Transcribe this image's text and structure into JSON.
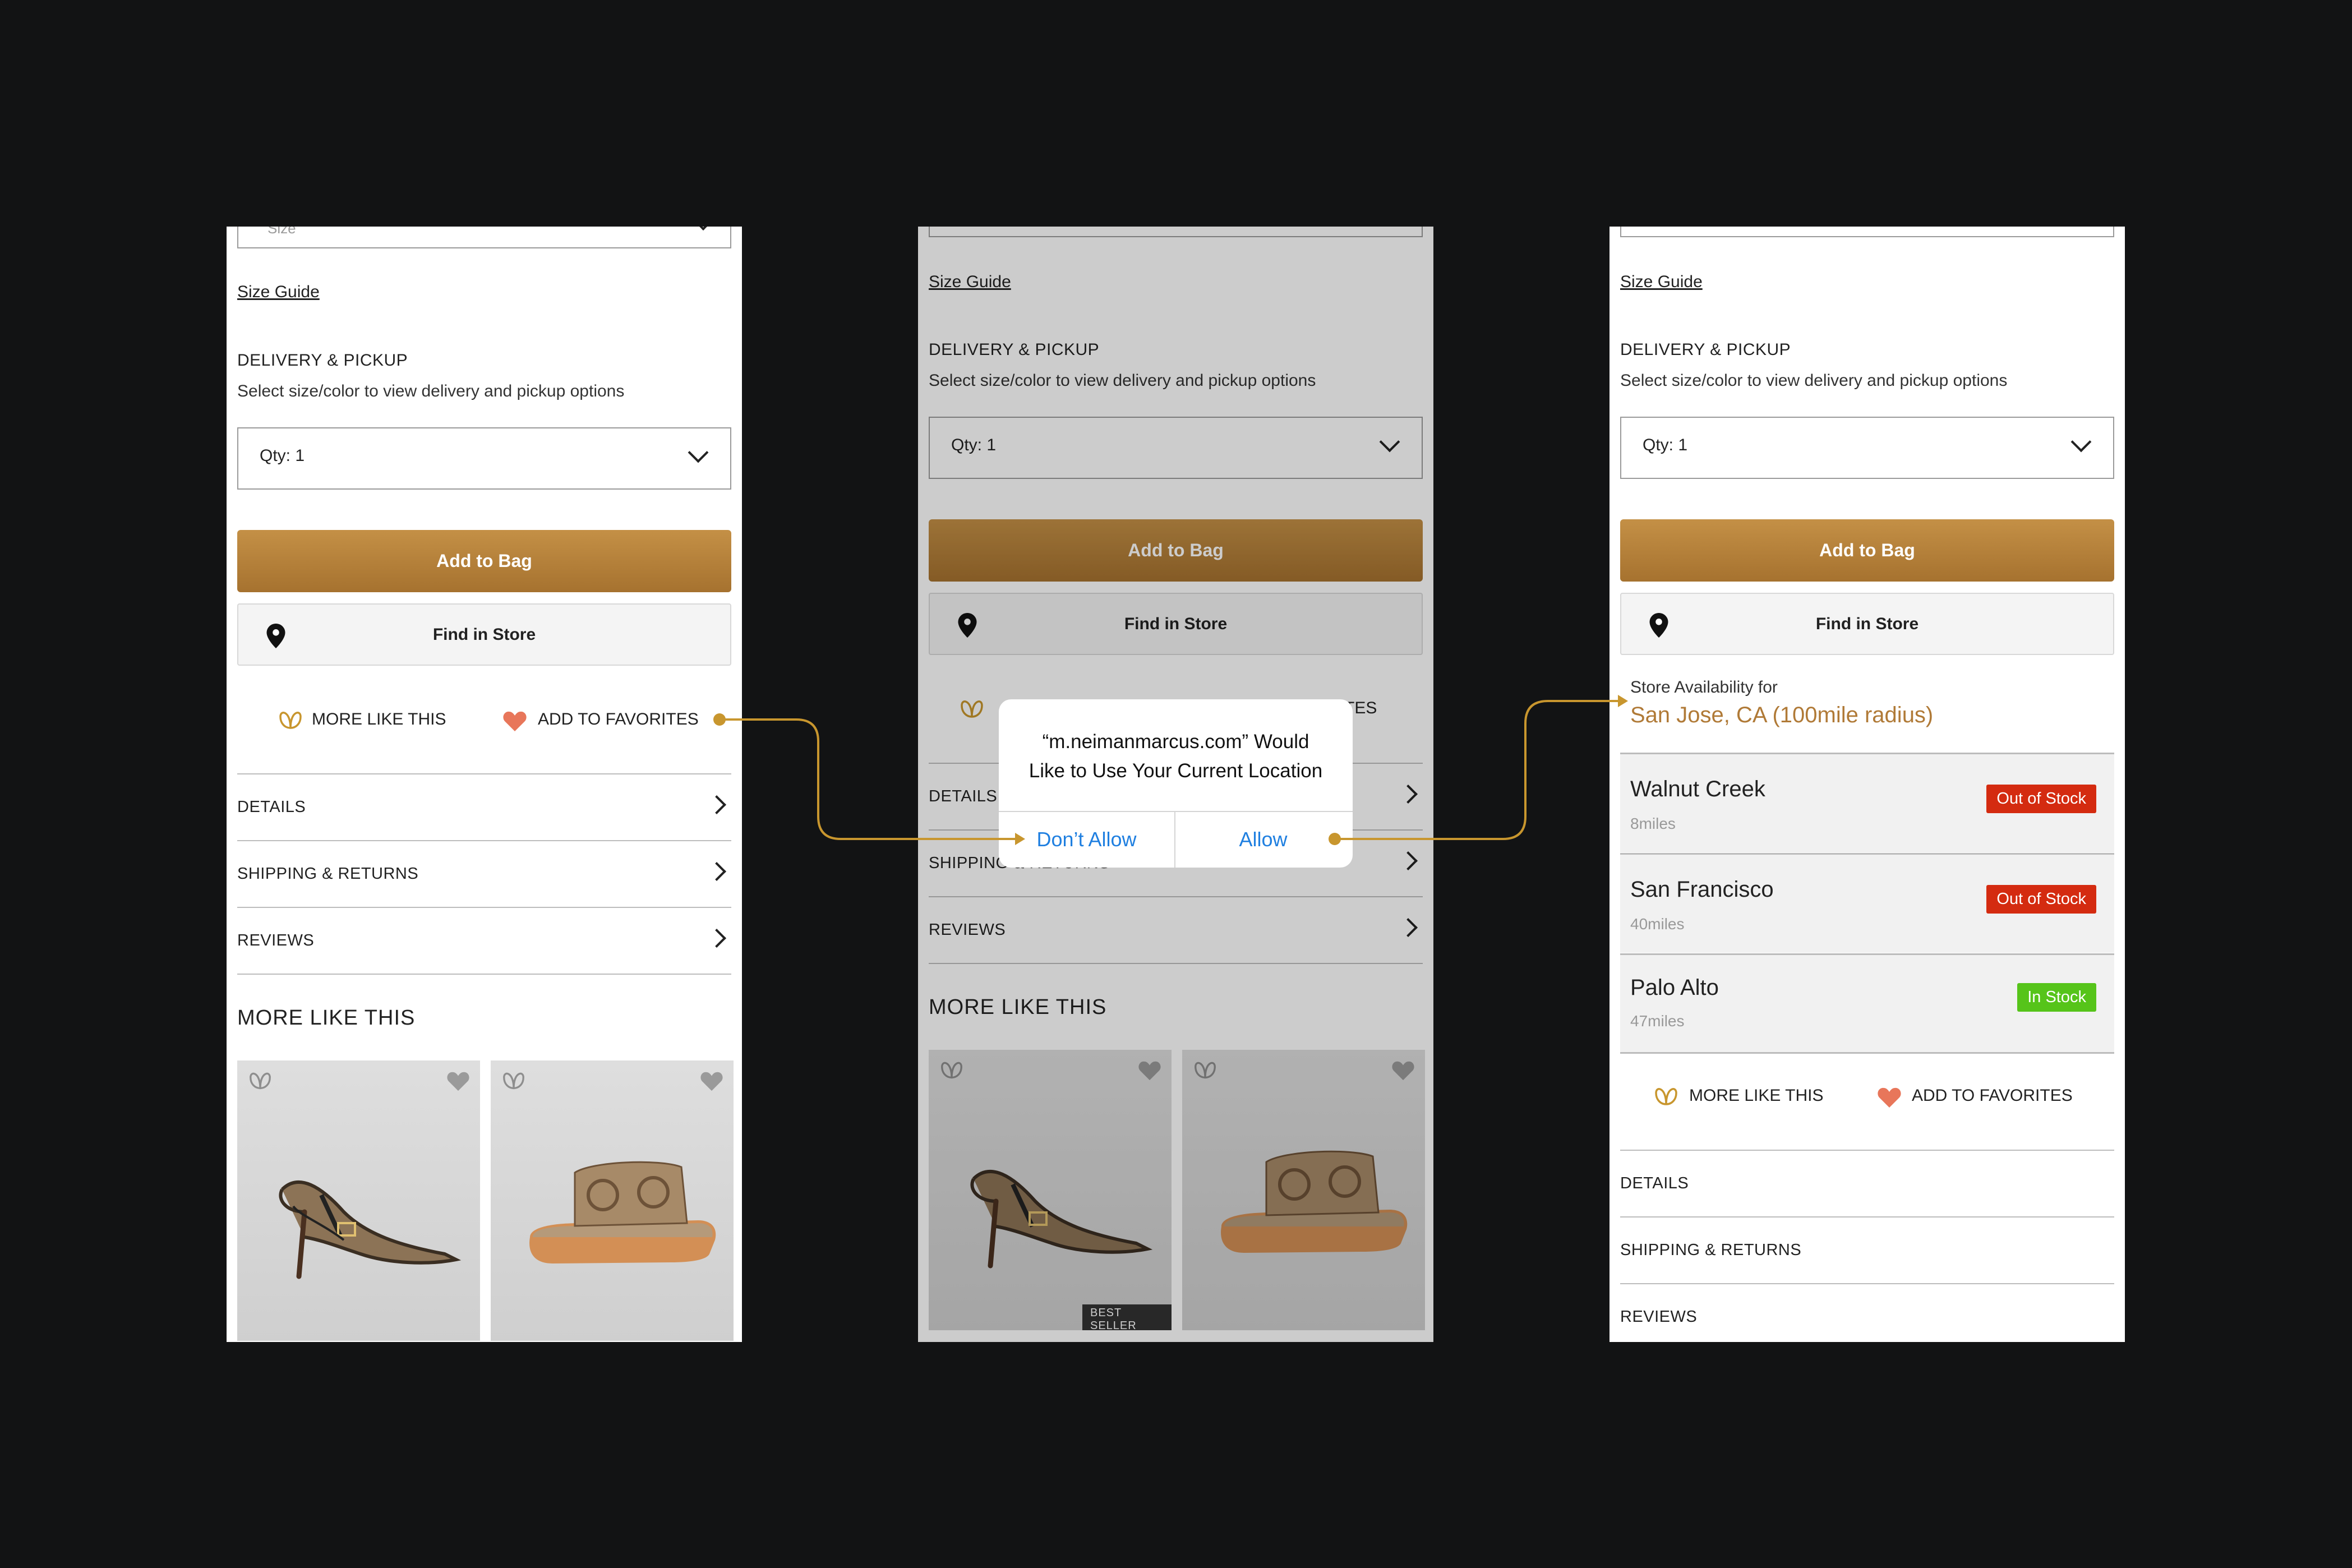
{
  "colors": {
    "background": "#121314",
    "accent_gold": "#b98a3a",
    "out_of_stock": "#d42b10",
    "in_stock": "#56c41a",
    "link_blue": "#1f7fe0"
  },
  "screen1": {
    "size_placeholder": "Size",
    "size_guide": "Size Guide",
    "delivery_title": "DELIVERY & PICKUP",
    "delivery_sub": "Select size/color to view delivery and pickup options",
    "qty": "Qty: 1",
    "add_to_bag": "Add to Bag",
    "find_in_store": "Find in Store",
    "more_like_this": "MORE LIKE THIS",
    "add_to_favorites": "ADD TO FAVORITES",
    "rows": [
      "DETAILS",
      "SHIPPING & RETURNS",
      "REVIEWS"
    ],
    "more_like_this_title": "MORE LIKE THIS"
  },
  "screen2": {
    "size_guide": "Size Guide",
    "delivery_title": "DELIVERY & PICKUP",
    "delivery_sub": "Select size/color to view delivery and pickup options",
    "qty": "Qty: 1",
    "add_to_bag": "Add to Bag",
    "find_in_store": "Find in Store",
    "favorites_fragment": "TES",
    "rows": [
      "DETAILS",
      "SHIPPING & RETURNS",
      "REVIEWS"
    ],
    "more_like_this_title": "MORE LIKE THIS",
    "badge": "BEST SELLER",
    "alert": {
      "line1": "“m.neimanmarcus.com” Would",
      "line2": "Like to Use Your Current Location",
      "dont_allow": "Don’t Allow",
      "allow": "Allow"
    }
  },
  "screen3": {
    "size_guide": "Size Guide",
    "delivery_title": "DELIVERY & PICKUP",
    "delivery_sub": "Select size/color to view delivery and pickup options",
    "qty": "Qty: 1",
    "add_to_bag": "Add to Bag",
    "find_in_store": "Find in Store",
    "store_availability_for": "Store Availability for",
    "store_location": "San Jose, CA (100mile radius)",
    "stores": [
      {
        "name": "Walnut Creek",
        "distance": "8miles",
        "status": "Out of Stock"
      },
      {
        "name": "San Francisco",
        "distance": "40miles",
        "status": "Out of Stock"
      },
      {
        "name": "Palo Alto",
        "distance": "47miles",
        "status": "In Stock"
      }
    ],
    "more_like_this": "MORE LIKE THIS",
    "add_to_favorites": "ADD TO FAVORITES",
    "rows": [
      "DETAILS",
      "SHIPPING & RETURNS",
      "REVIEWS"
    ]
  }
}
